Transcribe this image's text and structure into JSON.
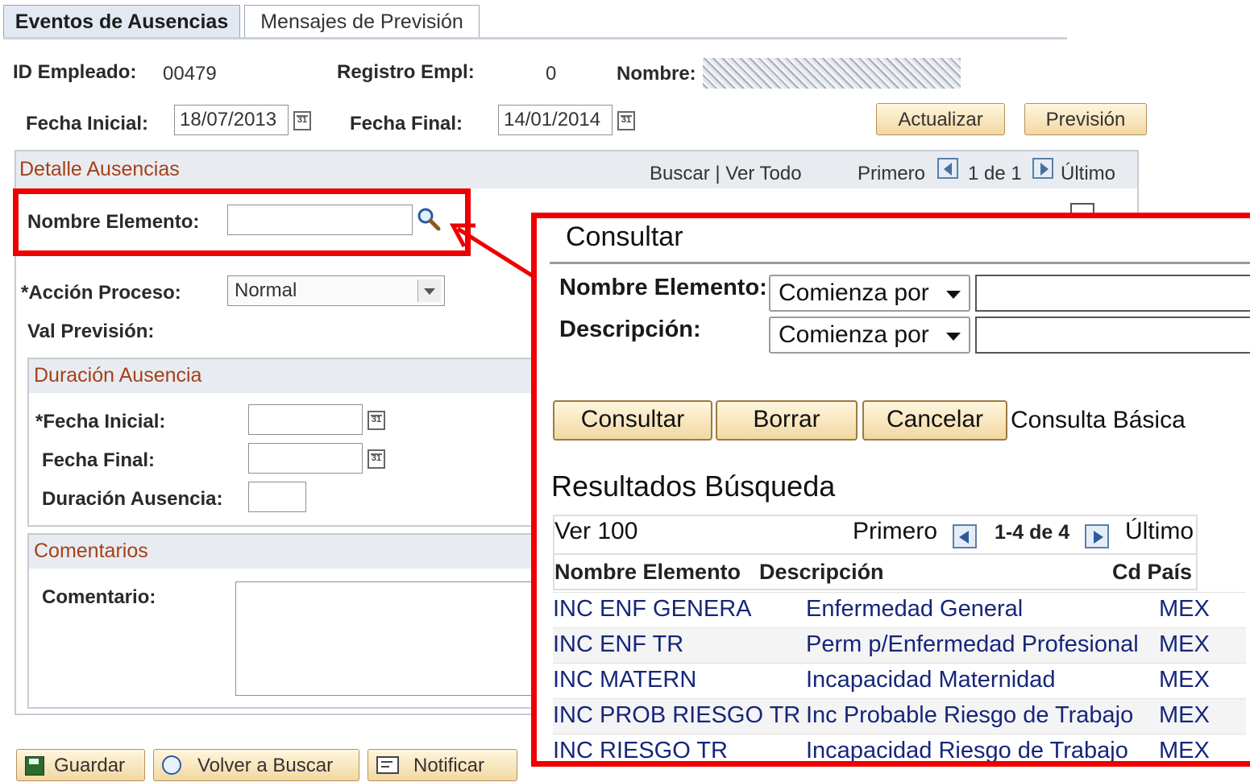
{
  "tabs": [
    {
      "label": "Eventos de Ausencias",
      "active": true
    },
    {
      "label": "Mensajes de Previsión",
      "active": false
    }
  ],
  "header": {
    "employee_id_label": "ID Empleado:",
    "employee_id_value": "00479",
    "record_label": "Registro Empl:",
    "record_value": "0",
    "name_label": "Nombre:",
    "start_date_label": "Fecha Inicial:",
    "start_date_value": "18/07/2013",
    "end_date_label": "Fecha Final:",
    "end_date_value": "14/01/2014",
    "update_button": "Actualizar",
    "forecast_button": "Previsión"
  },
  "detail": {
    "title": "Detalle Ausencias",
    "search_link": "Buscar",
    "separator": "|",
    "view_all_link": "Ver Todo",
    "first_label": "Primero",
    "page_info": "1 de 1",
    "last_label": "Último",
    "element_name_label": "Nombre Elemento:",
    "element_name_value": "",
    "process_action_label": "*Acción Proceso:",
    "process_action_value": "Normal",
    "forecast_value_label": "Val Previsión:"
  },
  "duration": {
    "title": "Duración Ausencia",
    "start_label": "*Fecha Inicial:",
    "end_label": "Fecha Final:",
    "duration_label": "Duración Ausencia:"
  },
  "comments": {
    "title": "Comentarios",
    "comment_label": "Comentario:"
  },
  "footer": {
    "save": "Guardar",
    "back_to_search": "Volver a Buscar",
    "notify": "Notificar"
  },
  "lookup": {
    "title": "Consultar",
    "element_name_label": "Nombre Elemento:",
    "element_name_operator": "Comienza por",
    "description_label": "Descripción:",
    "description_operator": "Comienza por",
    "search_button": "Consultar",
    "clear_button": "Borrar",
    "cancel_button": "Cancelar",
    "basic_lookup_link": "Consulta Básica",
    "results_title": "Resultados Búsqueda",
    "view_100": "Ver 100",
    "first_label": "Primero",
    "page_info": "1-4 de 4",
    "last_label": "Último",
    "columns": [
      "Nombre Elemento",
      "Descripción",
      "Cd País"
    ],
    "rows": [
      [
        "INC ENF GENERA",
        "Enfermedad General",
        "MEX"
      ],
      [
        "INC ENF TR",
        "Perm p/Enfermedad Profesional",
        "MEX"
      ],
      [
        "INC MATERN",
        "Incapacidad Maternidad",
        "MEX"
      ],
      [
        "INC PROB RIESGO TR",
        "Inc Probable Riesgo de Trabajo",
        "MEX"
      ],
      [
        "INC RIESGO TR",
        "Incapacidad Riesgo de Trabajo",
        "MEX"
      ]
    ]
  },
  "colors": {
    "highlight": "#ee0000",
    "section_title": "#a5401a",
    "link": "#15267a",
    "button_fill": "#f2d8a2"
  }
}
